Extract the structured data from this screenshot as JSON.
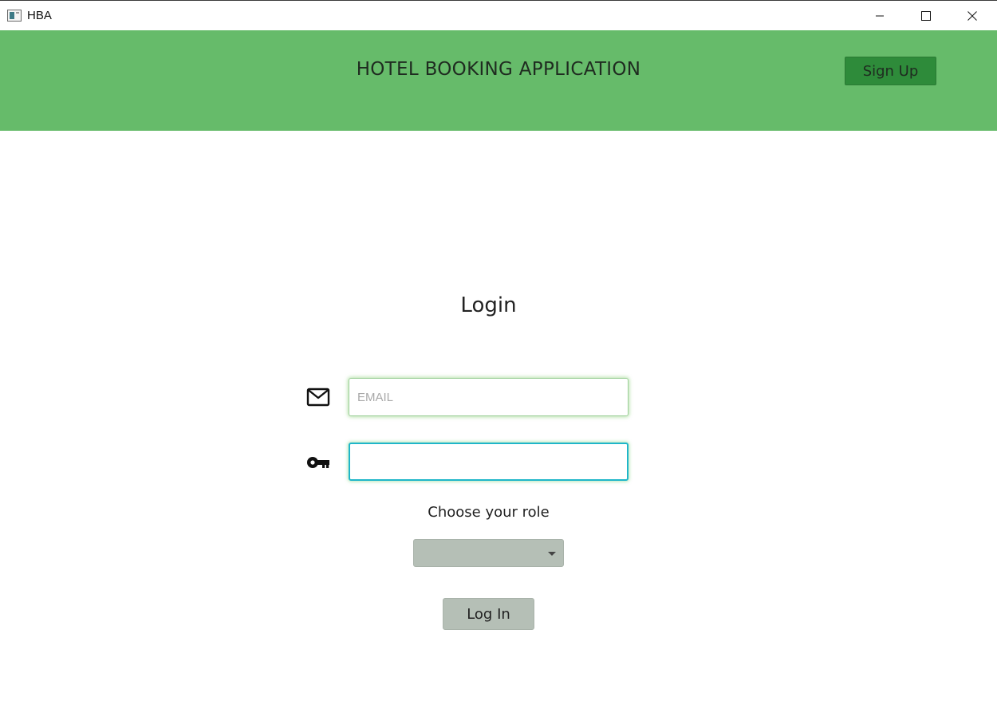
{
  "window": {
    "title": "HBA",
    "controls": [
      "minimize",
      "maximize",
      "close"
    ]
  },
  "header": {
    "title": "HOTEL BOOKING APPLICATION",
    "signup_label": "Sign Up",
    "background": "#66bb6a",
    "signup_color": "#2e8b3a"
  },
  "login": {
    "title": "Login",
    "email": {
      "icon": "mail-icon",
      "placeholder": "EMAIL",
      "value": ""
    },
    "password": {
      "icon": "key-icon",
      "placeholder": "",
      "value": ""
    },
    "role_label": "Choose your role",
    "role_value": "",
    "button_label": "Log In",
    "button_color": "#b5bfb6",
    "focus_color": "#1fb6c9"
  }
}
